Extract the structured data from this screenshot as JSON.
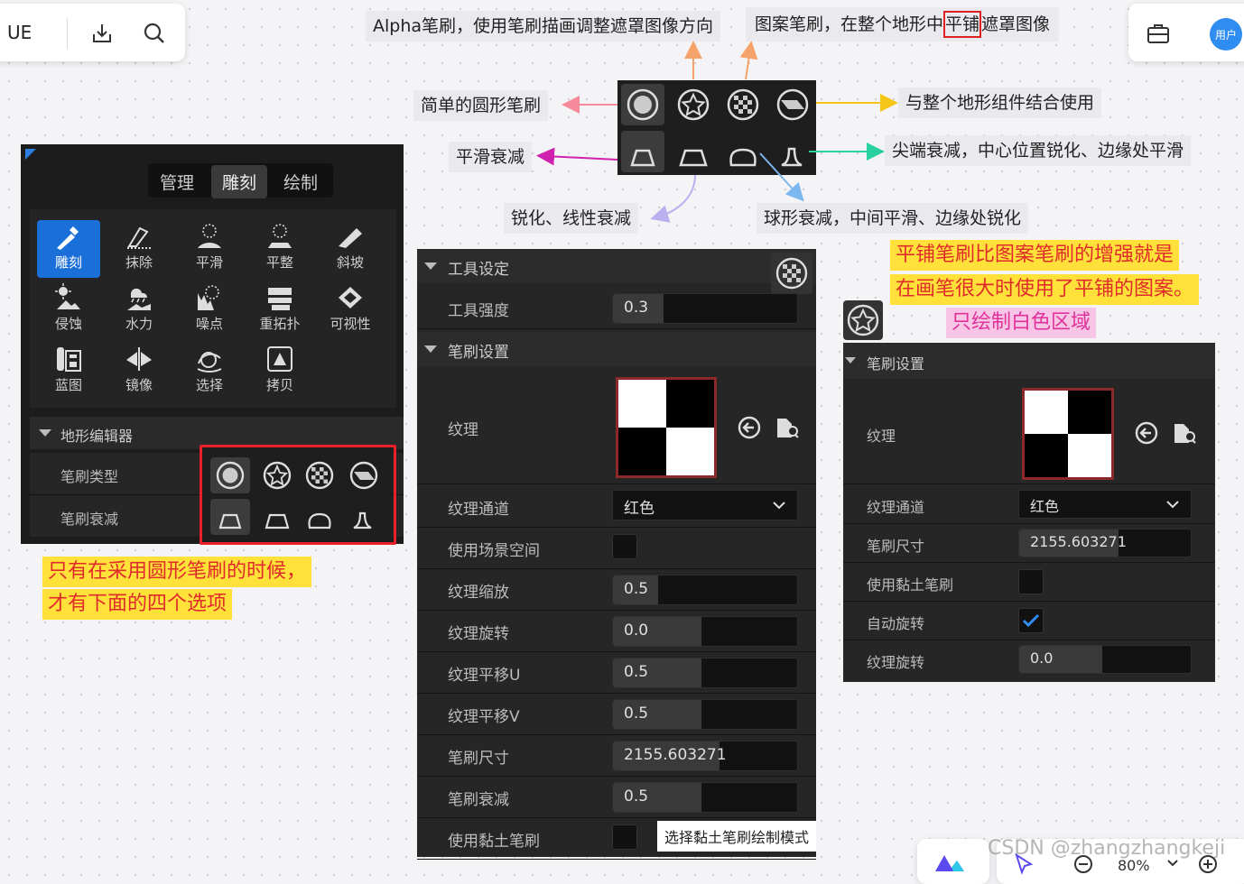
{
  "topbar": {
    "app_name": "UE",
    "download_icon": "download-icon",
    "search_icon": "search-icon",
    "user_label": "用户"
  },
  "annotations": {
    "alpha_brush": "Alpha笔刷，使用笔刷描画调整遮罩图像方向",
    "pattern_brush_before": "图案笔刷，在整个地形中",
    "pattern_brush_box": "平铺",
    "pattern_brush_after": "遮罩图像",
    "simple_round": "简单的圆形笔刷",
    "whole_terrain": "与整个地形组件结合使用",
    "smooth_falloff": "平滑衰减",
    "tip_falloff": "尖端衰减，中心位置锐化、边缘处平滑",
    "linear_falloff": "锐化、线性衰减",
    "sphere_falloff": "球形衰减，中间平滑、边缘处锐化",
    "tiled_note_1": "平铺笔刷比图案笔刷的增强就是",
    "tiled_note_2": "在画笔很大时使用了平铺的图案。",
    "white_only": "只绘制白色区域",
    "round_only_1": "只有在采用圆形笔刷的时候，",
    "round_only_2": "才有下面的四个选项",
    "clay_note": "选择黏土笔刷绘制模式"
  },
  "mode_tabs": [
    "管理",
    "雕刻",
    "绘制"
  ],
  "tools": [
    "雕刻",
    "抹除",
    "平滑",
    "平整",
    "斜坡",
    "侵蚀",
    "水力",
    "噪点",
    "重拓扑",
    "可视性",
    "蓝图",
    "镜像",
    "选择",
    "拷贝"
  ],
  "terrain_editor": {
    "section": "地形编辑器",
    "brush_type": "笔刷类型",
    "brush_falloff": "笔刷衰减"
  },
  "tool_settings": {
    "section": "工具设定",
    "strength_label": "工具强度",
    "strength": "0.3",
    "brush_section": "笔刷设置",
    "texture": "纹理",
    "channel_label": "纹理通道",
    "channel": "红色",
    "world_space": "使用场景空间",
    "scale_label": "纹理缩放",
    "scale": "0.5",
    "rotation_label": "纹理旋转",
    "rotation": "0.0",
    "pan_u_label": "纹理平移U",
    "pan_u": "0.5",
    "pan_v_label": "纹理平移V",
    "pan_v": "0.5",
    "size_label": "笔刷尺寸",
    "size": "2155.603271",
    "falloff_label": "笔刷衰减",
    "falloff": "0.5",
    "clay_label": "使用黏土笔刷"
  },
  "right_panel": {
    "section": "笔刷设置",
    "texture": "纹理",
    "channel_label": "纹理通道",
    "channel": "红色",
    "size_label": "笔刷尺寸",
    "size": "2155.603271",
    "clay_label": "使用黏土笔刷",
    "autorotate_label": "自动旋转",
    "rotation_label": "纹理旋转",
    "rotation": "0.0"
  },
  "watermark": "CSDN @zhangzhangkeji",
  "zoom": "80%"
}
